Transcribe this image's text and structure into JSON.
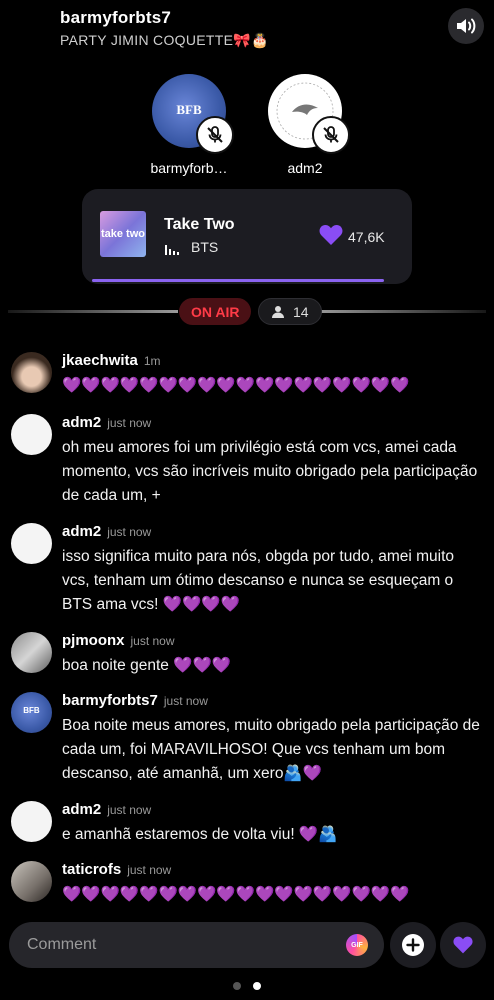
{
  "room": {
    "name": "barmyforbts7",
    "subtitle": "PARTY JIMIN COQUETTE🎀🎂"
  },
  "hosts": [
    {
      "name": "barmyforb…",
      "avatar_text": "BFB",
      "muted": true
    },
    {
      "name": "adm2",
      "muted": true
    }
  ],
  "now_playing": {
    "album_art_text": "take two",
    "title": "Take Two",
    "artist": "BTS",
    "likes": "47,6K"
  },
  "live": {
    "status_label": "ON AIR",
    "listener_count": "14"
  },
  "messages": [
    {
      "user": "jkaechwita",
      "time": "1m",
      "text": "💜💜💜💜💜💜💜💜💜💜💜💜💜💜💜💜💜💜"
    },
    {
      "user": "adm2",
      "time": "just now",
      "text": "oh meu amores foi um privilégio está com vcs, amei cada momento, vcs são incríveis muito obrigado pela participação de cada um, +"
    },
    {
      "user": "adm2",
      "time": "just now",
      "text": "isso significa muito para nós, obgda por tudo, amei muito vcs, tenham um ótimo descanso e nunca se esqueçam o BTS ama vcs! 💜💜💜💜"
    },
    {
      "user": "pjmoonx",
      "time": "just now",
      "text": "boa noite gente 💜💜💜"
    },
    {
      "user": "barmyforbts7",
      "time": "just now",
      "avatar_text": "BFB",
      "text": "Boa noite meus amores, muito obrigado pela participação de cada um, foi MARAVILHOSO! Que vcs tenham um bom descanso, até amanhã, um xero🫂💜"
    },
    {
      "user": "adm2",
      "time": "just now",
      "text": "e amanhã estaremos de volta viu! 💜🫂"
    },
    {
      "user": "taticrofs",
      "time": "just now",
      "text": "💜💜💜💜💜💜💜💜💜💜💜💜💜💜💜💜💜💜"
    }
  ],
  "composer": {
    "placeholder": "Comment",
    "gif_label": "GIF"
  },
  "pager": {
    "current_page": 2,
    "total_pages": 2
  },
  "colors": {
    "accent_purple": "#8a63f0",
    "on_air_red": "#ff3b47",
    "background": "#000000"
  }
}
